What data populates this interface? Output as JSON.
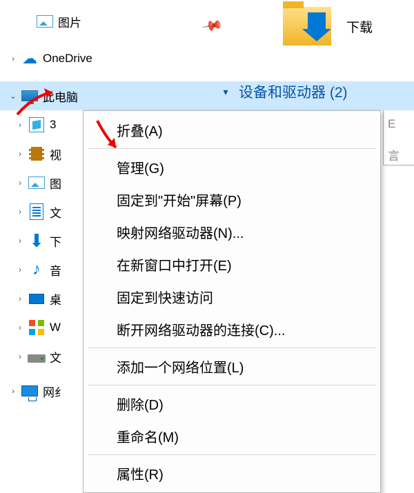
{
  "top_items": {
    "pictures": "图片",
    "onedrive": "OneDrive"
  },
  "this_pc": "此电脑",
  "children": {
    "threeD": "3",
    "videos": "视",
    "pictures2": "图",
    "documents": "文",
    "downloads": "下",
    "music": "音",
    "desktop": "桌",
    "w": "W",
    "drive": "文"
  },
  "network": "网纟",
  "downloads_tile": "下载",
  "devices_header": "设备和驱动器 (2)",
  "context_menu": {
    "collapse": "折叠(A)",
    "manage": "管理(G)",
    "pin_start": "固定到\"开始\"屏幕(P)",
    "map_drive": "映射网络驱动器(N)...",
    "open_new": "在新窗口中打开(E)",
    "pin_quick": "固定到快速访问",
    "disconnect": "断开网络驱动器的连接(C)...",
    "add_net": "添加一个网络位置(L)",
    "delete": "删除(D)",
    "rename": "重命名(M)",
    "properties": "属性(R)"
  },
  "edge_letters": {
    "top": "E",
    "mid": "言"
  }
}
